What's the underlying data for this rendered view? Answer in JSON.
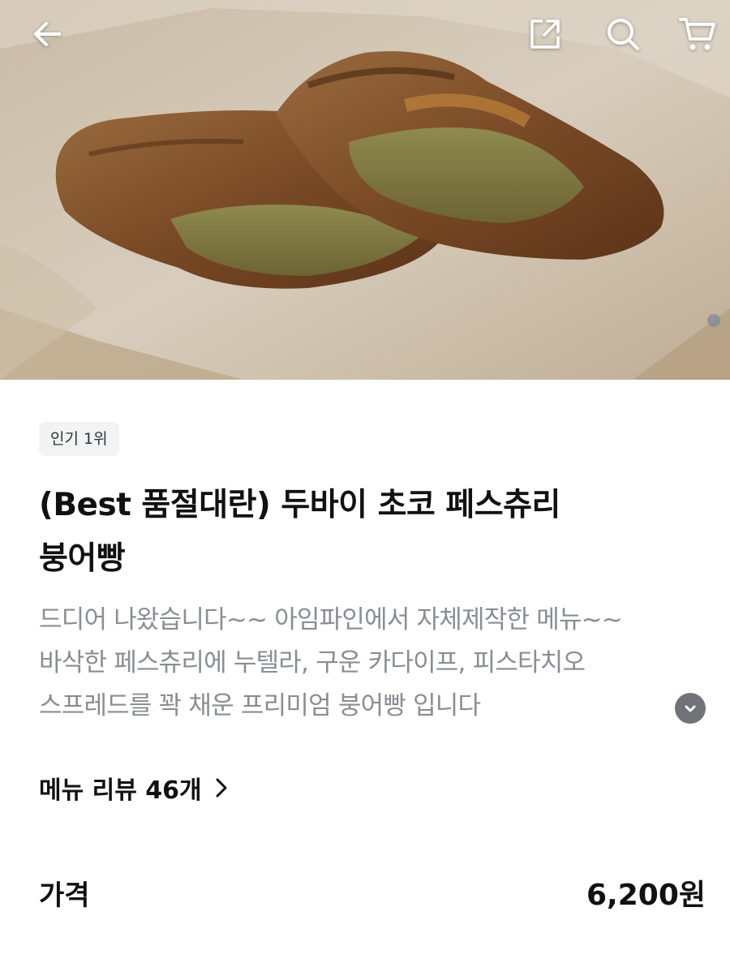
{
  "hero": {
    "image": "pastry-fish-bread-photo"
  },
  "header": {
    "back_icon": "arrow-left-icon",
    "share_icon": "share-icon",
    "search_icon": "search-icon",
    "cart_icon": "cart-icon"
  },
  "product": {
    "badge": "인기 1위",
    "title_lines": [
      "(Best 품절대란) 두바이 초코 페스츄리",
      "붕어빵"
    ],
    "description_lines": [
      "드디어 나왔습니다~~ 아임파인에서 자체제작한 메뉴~~",
      "바삭한 페스츄리에 누텔라, 구운 카다이프, 피스타치오",
      "스프레드를 꽉 채운 프리미엄 붕어빵 입니다"
    ],
    "expand_icon": "chevron-down-icon"
  },
  "reviews": {
    "label": "메뉴 리뷰 46개",
    "icon": "chevron-right-icon"
  },
  "price": {
    "label": "가격",
    "value": "6,200원"
  },
  "colors": {
    "text_primary": "#111111",
    "text_secondary": "#8a8d93",
    "badge_bg": "#f2f3f5",
    "expand_bg": "#6f7277"
  }
}
